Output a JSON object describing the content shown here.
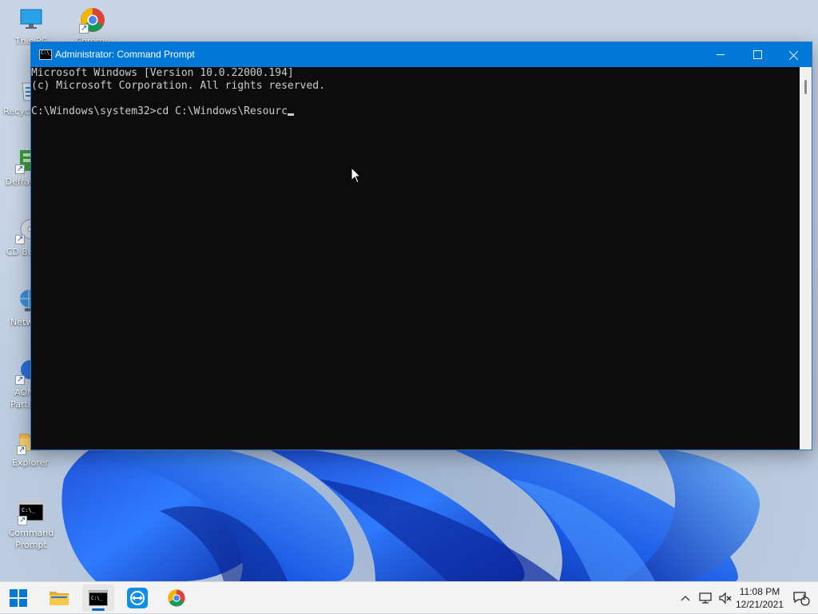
{
  "desktop": {
    "icons": [
      {
        "name": "this-pc",
        "label": "This PC"
      },
      {
        "name": "chrome",
        "label": "Chrome"
      },
      {
        "name": "recycle-bin",
        "label": "Recycle Bin"
      },
      {
        "name": "defraggler",
        "label": "Defraggler"
      },
      {
        "name": "cd-burner",
        "label": "CD Burner"
      },
      {
        "name": "network",
        "label": "Network"
      },
      {
        "name": "aomei-partition",
        "label": "AOMEI Partition"
      },
      {
        "name": "explorer",
        "label": "Explorer"
      },
      {
        "name": "command-prompt",
        "label": "Command Prompt"
      }
    ]
  },
  "window": {
    "title": "Administrator: Command Prompt",
    "icon_text": "C:\\_",
    "console_lines": [
      "Microsoft Windows [Version 10.0.22000.194]",
      "(c) Microsoft Corporation. All rights reserved.",
      "",
      "C:\\Windows\\system32>cd C:\\Windows\\Resourc"
    ]
  },
  "taskbar": {
    "apps": [
      {
        "name": "start",
        "active": false
      },
      {
        "name": "file-explorer",
        "active": false
      },
      {
        "name": "command-prompt",
        "active": true
      },
      {
        "name": "teamviewer",
        "active": false
      },
      {
        "name": "chrome",
        "active": false
      }
    ],
    "clock": {
      "time": "11:08 PM",
      "date": "12/21/2021"
    },
    "notification_count": "1"
  },
  "colors": {
    "titlebar": "#0078d7",
    "console_bg": "#0c0c0c",
    "console_fg": "#cccccc",
    "taskbar": "#f3f3f3",
    "accent": "#0067c0"
  }
}
